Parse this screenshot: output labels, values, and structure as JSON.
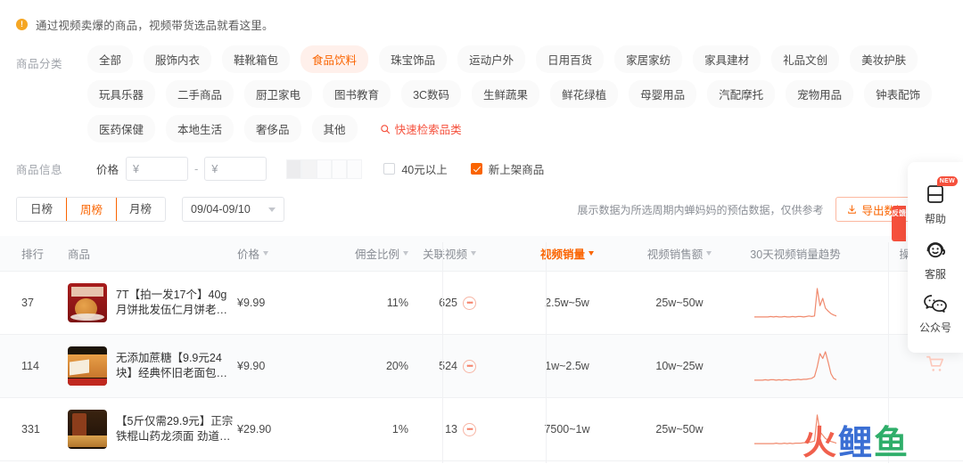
{
  "notice": {
    "icon": "info-icon",
    "text": "通过视频卖爆的商品，视频带货选品就看这里。"
  },
  "category_filter": {
    "label": "商品分类",
    "chips": [
      {
        "label": "全部",
        "active": false
      },
      {
        "label": "服饰内衣",
        "active": false
      },
      {
        "label": "鞋靴箱包",
        "active": false
      },
      {
        "label": "食品饮料",
        "active": true
      },
      {
        "label": "珠宝饰品",
        "active": false
      },
      {
        "label": "运动户外",
        "active": false
      },
      {
        "label": "日用百货",
        "active": false
      },
      {
        "label": "家居家纺",
        "active": false
      },
      {
        "label": "家具建材",
        "active": false
      },
      {
        "label": "礼品文创",
        "active": false
      },
      {
        "label": "美妆护肤",
        "active": false
      },
      {
        "label": "玩具乐器",
        "active": false
      },
      {
        "label": "二手商品",
        "active": false
      },
      {
        "label": "厨卫家电",
        "active": false
      },
      {
        "label": "图书教育",
        "active": false
      },
      {
        "label": "3C数码",
        "active": false
      },
      {
        "label": "生鲜蔬果",
        "active": false
      },
      {
        "label": "鲜花绿植",
        "active": false
      },
      {
        "label": "母婴用品",
        "active": false
      },
      {
        "label": "汽配摩托",
        "active": false
      },
      {
        "label": "宠物用品",
        "active": false
      },
      {
        "label": "钟表配饰",
        "active": false
      },
      {
        "label": "医药保健",
        "active": false
      },
      {
        "label": "本地生活",
        "active": false
      },
      {
        "label": "奢侈品",
        "active": false
      },
      {
        "label": "其他",
        "active": false
      }
    ],
    "search_chip": "快速检索品类"
  },
  "info_filter": {
    "label": "商品信息",
    "price_label": "价格",
    "price_min_prefix": "¥",
    "price_min_value": "",
    "price_min_placeholder": "",
    "separator": "-",
    "price_max_prefix": "¥",
    "price_max_value": "",
    "price_max_placeholder": "",
    "checkbox_over40": "40元以上",
    "checkbox_over40_checked": false,
    "checkbox_new": "新上架商品",
    "checkbox_new_checked": true
  },
  "toolbar": {
    "tabs": [
      {
        "label": "日榜",
        "active": false
      },
      {
        "label": "周榜",
        "active": true
      },
      {
        "label": "月榜",
        "active": false
      }
    ],
    "date_range": "09/04-09/10",
    "hint": "展示数据为所选周期内蝉妈妈的预估数据，仅供参考",
    "export_label": "导出数据",
    "export_icon": "download-icon",
    "secondary_button_label": "反"
  },
  "table": {
    "columns": [
      {
        "key": "rank",
        "label": "排行",
        "sortable": false,
        "sorted": false
      },
      {
        "key": "product",
        "label": "商品",
        "sortable": false,
        "sorted": false
      },
      {
        "key": "price",
        "label": "价格",
        "sortable": true,
        "sorted": false
      },
      {
        "key": "commission",
        "label": "佣金比例",
        "sortable": true,
        "sorted": false
      },
      {
        "key": "videos",
        "label": "关联视频",
        "sortable": true,
        "sorted": false
      },
      {
        "key": "video_sales",
        "label": "视频销量",
        "sortable": true,
        "sorted": true
      },
      {
        "key": "video_amount",
        "label": "视频销售额",
        "sortable": true,
        "sorted": false
      },
      {
        "key": "trend",
        "label": "30天视频销量趋势",
        "sortable": false,
        "sorted": false
      },
      {
        "key": "op",
        "label": "操作",
        "sortable": false,
        "sorted": false
      }
    ],
    "rows": [
      {
        "rank": "37",
        "title": "7T【拍一发17个】40g月饼批发伍仁月饼老式月饼广…",
        "thumb": "mooncake-thumbnail",
        "price": "¥9.99",
        "commission": "11%",
        "videos": "625",
        "video_sales": "2.5w~5w",
        "video_amount": "25w~50w",
        "trend": [
          2,
          2,
          2,
          2,
          2,
          2,
          3,
          2,
          3,
          2,
          2,
          3,
          2,
          2,
          3,
          2,
          3,
          3,
          2,
          3,
          4,
          3,
          4,
          60,
          25,
          40,
          20,
          14,
          9,
          6,
          4
        ]
      },
      {
        "rank": "114",
        "title": "无添加蔗糖【9.9元24块】经典怀旧老面包家庭实惠…",
        "thumb": "bread-thumbnail",
        "price": "¥9.90",
        "commission": "20%",
        "videos": "524",
        "video_sales": "1w~2.5w",
        "video_amount": "10w~25w",
        "trend": [
          2,
          2,
          2,
          2,
          3,
          2,
          3,
          3,
          2,
          3,
          2,
          3,
          3,
          2,
          3,
          3,
          4,
          3,
          4,
          4,
          5,
          6,
          10,
          30,
          58,
          48,
          62,
          40,
          16,
          6,
          3
        ]
      },
      {
        "rank": "331",
        "title": "【5斤仅需29.9元】正宗铁棍山药龙须面 劲道顺滑 …",
        "thumb": "noodle-thumbnail",
        "price": "¥29.90",
        "commission": "1%",
        "videos": "13",
        "video_sales": "7500~1w",
        "video_amount": "25w~50w",
        "trend": [
          2,
          2,
          2,
          2,
          2,
          2,
          2,
          2,
          3,
          2,
          2,
          3,
          2,
          3,
          2,
          3,
          3,
          3,
          4,
          4,
          5,
          6,
          8,
          70,
          30,
          22,
          14,
          10,
          7,
          5,
          3
        ]
      }
    ]
  },
  "side_panel": {
    "tab_label": "反馈",
    "items": [
      {
        "label": "帮助",
        "icon": "book-icon",
        "badge": "NEW"
      },
      {
        "label": "客服",
        "icon": "headset-icon",
        "badge": ""
      },
      {
        "label": "公众号",
        "icon": "wechat-icon",
        "badge": ""
      }
    ],
    "cart_icon": "cart-icon"
  },
  "watermark": {
    "part1": "火",
    "part2": "鲤",
    "part3": "鱼"
  },
  "colors": {
    "accent": "#fa6400",
    "accent_light": "#fff0eb",
    "search_red": "#f5503c",
    "trend_line": "#f08a6e",
    "border": "#e3e5e9",
    "row_alt": "#fafbfc"
  }
}
